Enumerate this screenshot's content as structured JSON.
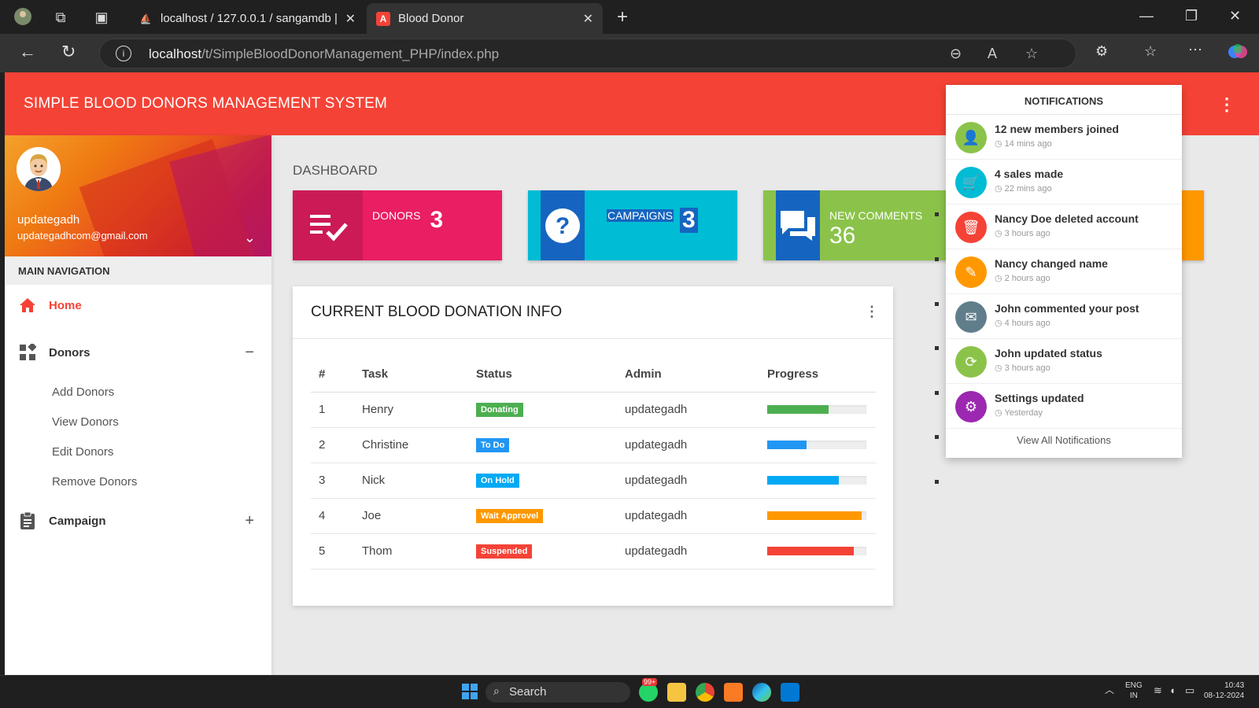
{
  "browser": {
    "tabs": [
      {
        "label": "localhost / 127.0.0.1 / sangamdb |",
        "active": false
      },
      {
        "label": "Blood Donor",
        "active": true
      }
    ],
    "url_host": "localhost",
    "url_path": "/t/SimpleBloodDonorManagement_PHP/index.php"
  },
  "app": {
    "title": "SIMPLE BLOOD DONORS MANAGEMENT SYSTEM",
    "accent": "#f44336"
  },
  "user": {
    "name": "updategadh",
    "email": "updategadhcom@gmail.com"
  },
  "sidebar": {
    "header": "MAIN NAVIGATION",
    "items": [
      {
        "label": "Home",
        "icon": "home-icon",
        "active": true
      },
      {
        "label": "Donors",
        "icon": "widgets-icon",
        "toggle": "−"
      },
      {
        "label": "Campaign",
        "icon": "clipboard-icon",
        "toggle": "+"
      }
    ],
    "donors_sub": [
      "Add Donors",
      "View Donors",
      "Edit Donors",
      "Remove Donors"
    ]
  },
  "dashboard": {
    "title": "DASHBOARD",
    "boxes": [
      {
        "label": "DONORS",
        "value": "3",
        "color": "#e91e63",
        "icon": "playlist-check-icon"
      },
      {
        "label": "CAMPAIGNS",
        "value": "3",
        "color": "#00bcd4",
        "icon": "help-icon"
      },
      {
        "label": "NEW COMMENTS",
        "value": "36",
        "color": "#8bc34a",
        "icon": "forum-icon"
      }
    ]
  },
  "donation_card": {
    "title": "CURRENT BLOOD DONATION INFO",
    "columns": [
      "#",
      "Task",
      "Status",
      "Admin",
      "Progress"
    ],
    "rows": [
      {
        "num": "1",
        "task": "Henry",
        "status": "Donating",
        "status_color": "#4caf50",
        "admin": "updategadh",
        "progress": 0.62,
        "bar_color": "#4caf50"
      },
      {
        "num": "2",
        "task": "Christine",
        "status": "To Do",
        "status_color": "#2196f3",
        "admin": "updategadh",
        "progress": 0.4,
        "bar_color": "#2196f3"
      },
      {
        "num": "3",
        "task": "Nick",
        "status": "On Hold",
        "status_color": "#03a9f4",
        "admin": "updategadh",
        "progress": 0.72,
        "bar_color": "#03a9f4"
      },
      {
        "num": "4",
        "task": "Joe",
        "status": "Wait Approvel",
        "status_color": "#ff9800",
        "admin": "updategadh",
        "progress": 0.95,
        "bar_color": "#ff9800"
      },
      {
        "num": "5",
        "task": "Thom",
        "status": "Suspended",
        "status_color": "#f44336",
        "admin": "updategadh",
        "progress": 0.87,
        "bar_color": "#f44336"
      }
    ]
  },
  "notifications": {
    "header": "NOTIFICATIONS",
    "items": [
      {
        "title": "12 new members joined",
        "time": "14 mins ago",
        "color": "#8bc34a",
        "icon": "person-add-icon"
      },
      {
        "title": "4 sales made",
        "time": "22 mins ago",
        "color": "#00bcd4",
        "icon": "cart-icon"
      },
      {
        "title": "Nancy Doe deleted account",
        "time": "3 hours ago",
        "color": "#f44336",
        "icon": "delete-icon"
      },
      {
        "title": "Nancy changed name",
        "time": "2 hours ago",
        "color": "#ff9800",
        "icon": "edit-icon"
      },
      {
        "title": "John commented your post",
        "time": "4 hours ago",
        "color": "#607d8b",
        "icon": "comment-icon"
      },
      {
        "title": "John updated status",
        "time": "3 hours ago",
        "color": "#8bc34a",
        "icon": "cached-icon"
      },
      {
        "title": "Settings updated",
        "time": "Yesterday",
        "color": "#9c27b0",
        "icon": "settings-icon"
      }
    ],
    "footer": "View All Notifications"
  },
  "taskbar": {
    "search": "Search",
    "badge": "99+",
    "lang": "ENG",
    "region": "IN",
    "time": "10:43",
    "date": "08-12-2024"
  }
}
